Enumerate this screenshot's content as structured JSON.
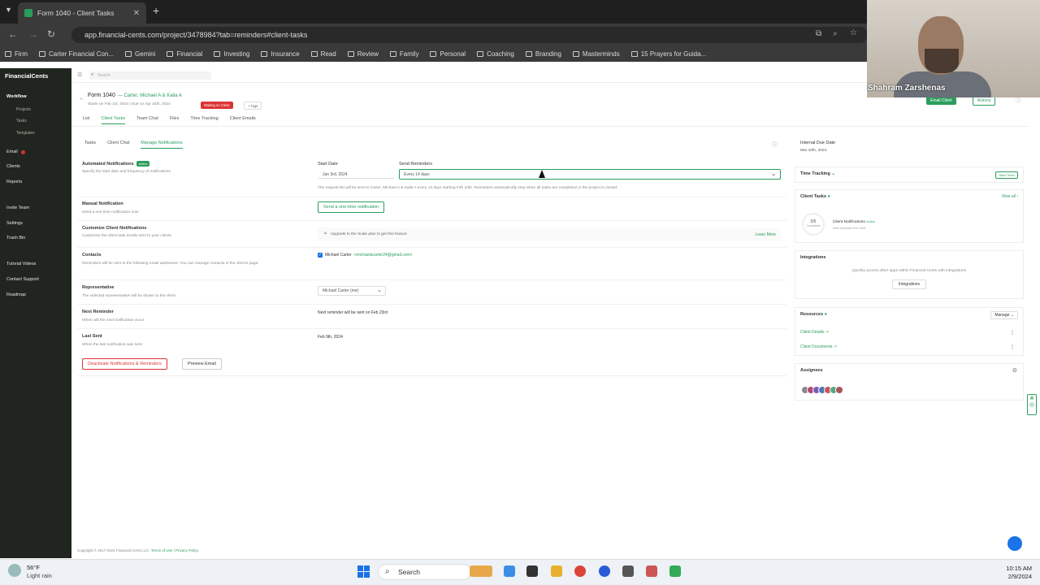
{
  "browser": {
    "tab_title": "Form 1040 - Client Tasks",
    "url": "app.financial-cents.com/project/3478984?tab=reminders#client-tasks",
    "bookmarks": [
      "Firm",
      "Carter Financial Con...",
      "Gemini",
      "Financial",
      "Investing",
      "Insurance",
      "Read",
      "Review",
      "Family",
      "Personal",
      "Coaching",
      "Branding",
      "Masterminds",
      "15 Prayers for Guida..."
    ]
  },
  "sidebar": {
    "brand": "FinancialCents",
    "items": [
      {
        "label": "Workflow",
        "active": true
      },
      {
        "label": "Projects",
        "sub": true
      },
      {
        "label": "Tasks",
        "sub": true
      },
      {
        "label": "Templates",
        "sub": true
      },
      {
        "label": "Email",
        "badge": true
      },
      {
        "label": "Clients"
      },
      {
        "label": "Reports"
      },
      {
        "label": "Invite Team"
      },
      {
        "label": "Settings"
      },
      {
        "label": "Trash Bin"
      },
      {
        "label": "Tutorial Videos"
      },
      {
        "label": "Contact Support"
      },
      {
        "label": "Roadmap"
      }
    ]
  },
  "search": {
    "placeholder": "Search"
  },
  "project": {
    "title": "Form 1040",
    "client": "— Carter, Michael A & Kaila A",
    "dates": "Starts on Feb 1st, 2024 | Due on Apr 15th, 2024",
    "status": "Waiting on Client",
    "tag": "+ Tags",
    "email_client": "Email Client",
    "actions": "Actions",
    "tabs": [
      "List",
      "Client Tasks",
      "Team Chat",
      "Files",
      "Time Tracking",
      "Client Emails"
    ],
    "subtabs": [
      "Tasks",
      "Client Chat",
      "Manage Notifications"
    ]
  },
  "settings": {
    "auto_label": "Automated Notifications",
    "auto_badge": "Active",
    "auto_desc": "Specify the start date and frequency of notifications",
    "start_label": "Start Date",
    "start_value": "Jan 3rd, 2024",
    "send_label": "Send Reminders",
    "send_value": "Every 14 days",
    "send_note": "The request list will be sent to Carter, Michael A & Kaila A every 14 days starting Feb 10th. Reminders automatically stop when all tasks are completed or the project is closed.",
    "manual_label": "Manual Notification",
    "manual_desc": "Send a one time notification now",
    "manual_btn": "Send a one-time notification",
    "custom_label": "Customize Client Notifications",
    "custom_desc": "Customize the client task emails sent to your clients",
    "upgrade": "Upgrade to the Scale plan to get this feature",
    "learn_more": "Learn More",
    "contacts_label": "Contacts",
    "contacts_desc": "Reminders will be sent to the following email addresses. You can manage contacts in the client's page.",
    "contact_name": "Michael Carter",
    "contact_email": "<michaelacarter24@gmail.com>",
    "rep_label": "Representative",
    "rep_desc": "The selected representative will be shown to the client",
    "rep_value": "Michael Carter (me)",
    "next_label": "Next Reminder",
    "next_desc": "When will the next notification occur",
    "next_value": "Next reminder will be sent on Feb 23rd",
    "last_label": "Last Sent",
    "last_desc": "When the last notification was sent",
    "last_value": "Feb 9th, 2024",
    "deactivate_btn": "Deactivate Notifications & Reminders",
    "preview_btn": "Preview Email"
  },
  "right": {
    "due_label": "Internal Due Date",
    "due_value": "Mar 10th, 2024",
    "time_tracking": "Time Tracking",
    "start_timer": "Start Timer",
    "client_tasks": "Client Tasks",
    "view_all": "View all",
    "progress": "0/5",
    "completed": "Completed",
    "ct_item": "Client Notifications",
    "ct_item_status": "Active",
    "ct_item_sub": "Next reminder Feb 23rd",
    "integrations": "Integrations",
    "integ_desc": "Quickly access other apps within Financial Cents with integrations",
    "integ_btn": "Integrations",
    "resources": "Resources",
    "manage": "Manage",
    "res1": "Client Details",
    "res2": "Client Documents",
    "assignees": "Assignees"
  },
  "footer": {
    "copyright": "Copyright © 2017-2024 Financial Cents LLC.",
    "terms": "Terms of Use",
    "privacy": "Privacy Policy"
  },
  "video": {
    "name": "Shahram Zarshenas"
  },
  "taskbar": {
    "temp": "56°F",
    "weather": "Light rain",
    "search": "Search",
    "time": "10:15 AM",
    "date": "2/9/2024"
  }
}
